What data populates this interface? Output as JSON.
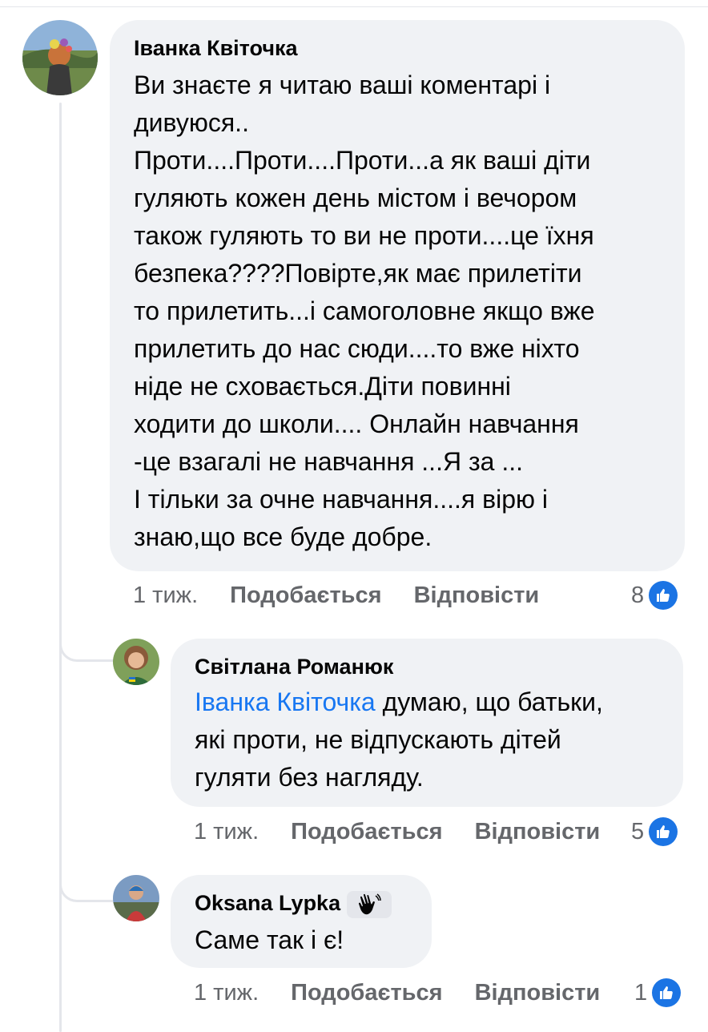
{
  "comments": [
    {
      "author": "Іванка Квіточка",
      "text": "Ви знаєте я читаю ваші коментарі і\nдивуюся..\nПроти....Проти....Проти...а як ваші діти\nгуляють кожен день містом і вечором\nтакож гуляють то ви не проти....це їхня\nбезпека????Повірте,як має прилетіти\nто прилетить...і самоголовне якщо вже\nприлетить до нас сюди....то вже ніхто\nніде не сховається.Діти повинні\nходити до школи.... Онлайн навчання\n-це взагалі не навчання ...Я за ...\nІ тільки за очне навчання....я вірю і\nзнаю,що все буде добре.",
      "time": "1 тиж.",
      "like_label": "Подобається",
      "reply_label": "Відповісти",
      "reactions": "8"
    },
    {
      "author": "Світлана Романюк",
      "mention": "Іванка Квіточка",
      "text_line1": " думаю, що батьки,",
      "text_rest": "які проти, не відпускають дітей\nгуляти без нагляду.",
      "time": "1 тиж.",
      "like_label": "Подобається",
      "reply_label": "Відповісти",
      "reactions": "5"
    },
    {
      "author": "Oksana Lypka",
      "text": "Саме так і є!",
      "time": "1 тиж.",
      "like_label": "Подобається",
      "reply_label": "Відповісти",
      "reactions": "1"
    }
  ],
  "colors": {
    "bubble": "#f0f2f5",
    "mention": "#1877f2",
    "like": "#1b74e4",
    "meta": "#65676b"
  },
  "icons": {
    "like": "thumbs-up-icon",
    "badge": "waving-hand-icon"
  }
}
